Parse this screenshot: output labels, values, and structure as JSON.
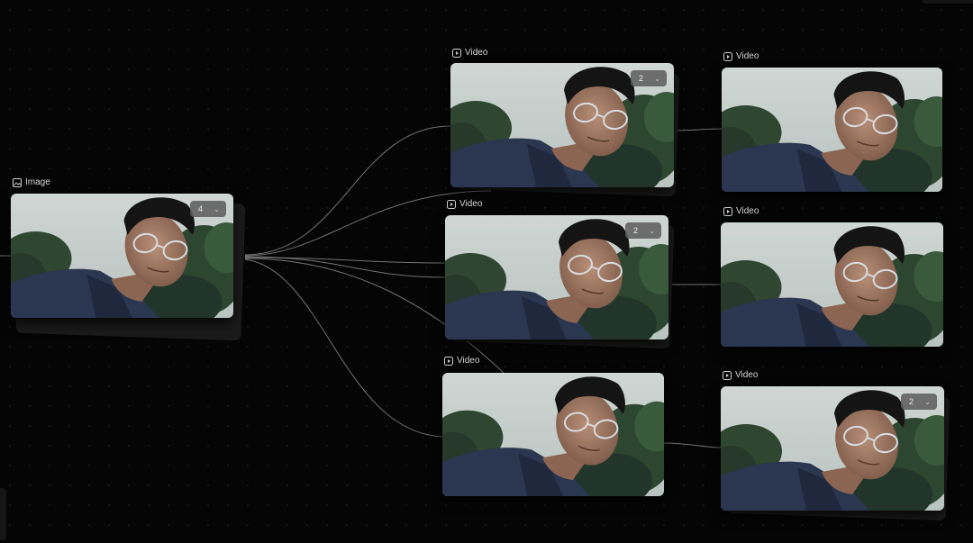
{
  "nodes": [
    {
      "id": "image",
      "label": "Image",
      "type": "image",
      "count": "4"
    },
    {
      "id": "video-1",
      "label": "Video",
      "type": "video",
      "count": "2"
    },
    {
      "id": "video-2",
      "label": "Video",
      "type": "video",
      "count": "2"
    },
    {
      "id": "video-3",
      "label": "Video",
      "type": "video",
      "count": null
    },
    {
      "id": "video-4",
      "label": "Video",
      "type": "video",
      "count": null
    },
    {
      "id": "video-5",
      "label": "Video",
      "type": "video",
      "count": null
    },
    {
      "id": "video-6",
      "label": "Video",
      "type": "video",
      "count": "2"
    }
  ],
  "dropdown_icon": "chevron-down-icon",
  "colors": {
    "canvas": "#050505",
    "edge": "#9a9a9a",
    "label": "#d4d4d4"
  }
}
